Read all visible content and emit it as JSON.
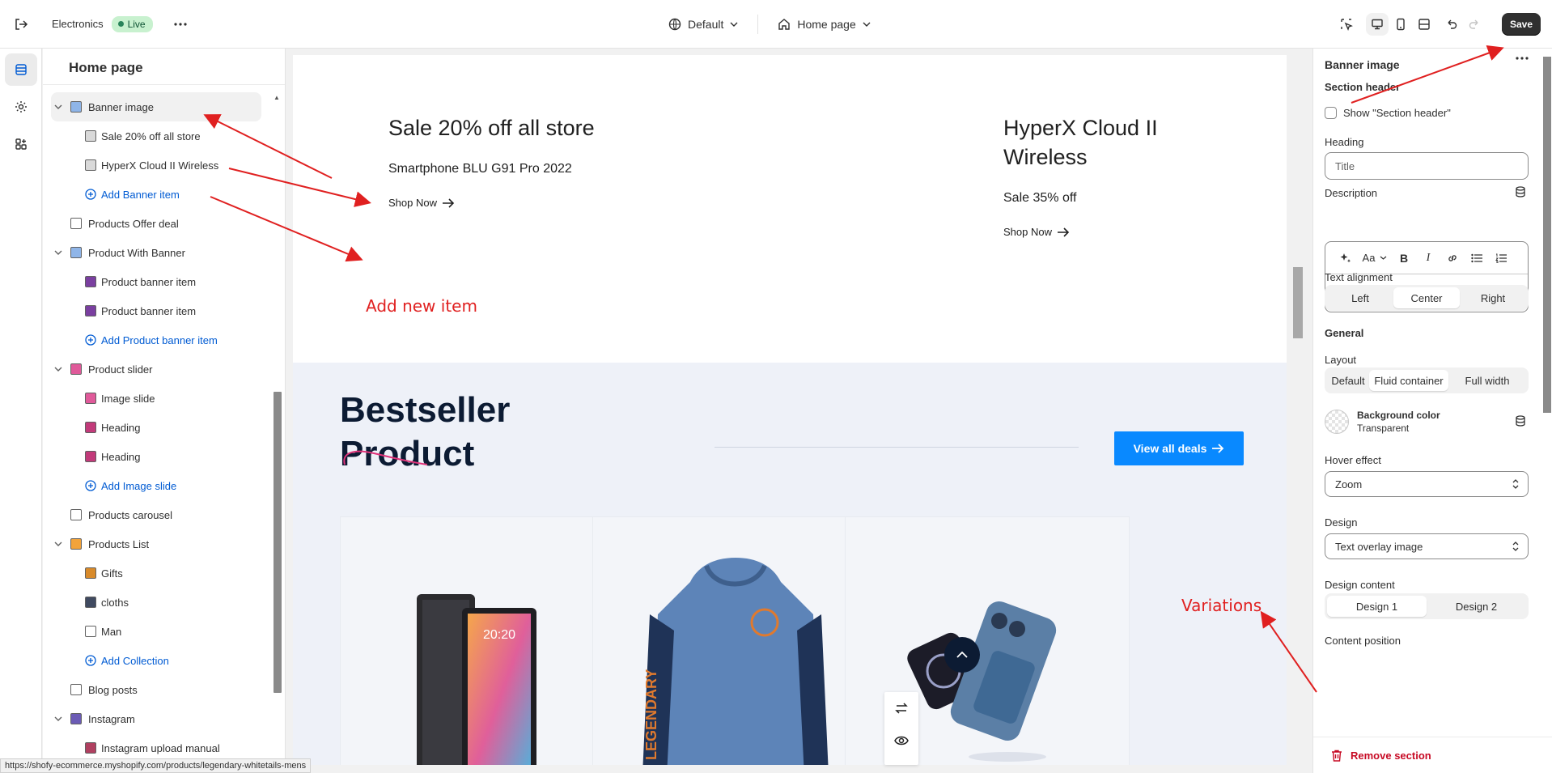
{
  "topbar": {
    "store_name": "Electronics",
    "status_badge": "Live",
    "theme_select": "Default",
    "page_select": "Home page",
    "save_label": "Save"
  },
  "sidebar": {
    "title": "Home page",
    "items": [
      {
        "label": "Banner image",
        "level": 1,
        "selected": true,
        "expanded": true,
        "icon": "banner-icon"
      },
      {
        "label": "Sale 20% off all store",
        "level": 2,
        "icon": "banner-item-icon"
      },
      {
        "label": "HyperX Cloud II Wireless",
        "level": 2,
        "icon": "banner-item-icon"
      },
      {
        "label": "Add Banner item",
        "level": 2,
        "add": true,
        "icon": "plus-circle-icon"
      },
      {
        "label": "Products Offer deal",
        "level": 1,
        "icon": "section-icon"
      },
      {
        "label": "Product With Banner",
        "level": 1,
        "expanded": true,
        "icon": "banner-icon"
      },
      {
        "label": "Product banner item",
        "level": 2,
        "icon": "product-banner-icon"
      },
      {
        "label": "Product banner item",
        "level": 2,
        "icon": "product-banner-icon"
      },
      {
        "label": "Add Product banner item",
        "level": 2,
        "add": true,
        "icon": "plus-circle-icon"
      },
      {
        "label": "Product slider",
        "level": 1,
        "expanded": true,
        "icon": "slider-icon"
      },
      {
        "label": "Image slide",
        "level": 2,
        "icon": "slide-icon"
      },
      {
        "label": "Heading",
        "level": 2,
        "icon": "heading-icon"
      },
      {
        "label": "Heading",
        "level": 2,
        "icon": "heading-icon"
      },
      {
        "label": "Add Image slide",
        "level": 2,
        "add": true,
        "icon": "plus-circle-icon"
      },
      {
        "label": "Products carousel",
        "level": 1,
        "icon": "section-icon"
      },
      {
        "label": "Products List",
        "level": 1,
        "expanded": true,
        "icon": "list-icon"
      },
      {
        "label": "Gifts",
        "level": 2,
        "icon": "gift-icon"
      },
      {
        "label": "cloths",
        "level": 2,
        "icon": "shirt-icon"
      },
      {
        "label": "Man",
        "level": 2,
        "icon": "tag-icon"
      },
      {
        "label": "Add Collection",
        "level": 2,
        "add": true,
        "icon": "plus-circle-icon"
      },
      {
        "label": "Blog posts",
        "level": 1,
        "icon": "blog-icon"
      },
      {
        "label": "Instagram",
        "level": 1,
        "expanded": true,
        "icon": "instagram-icon"
      },
      {
        "label": "Instagram upload manual",
        "level": 2,
        "icon": "image-icon"
      }
    ]
  },
  "preview": {
    "banner1": {
      "title": "Sale 20% off all store",
      "subtitle": "Smartphone BLU G91 Pro 2022",
      "cta": "Shop Now"
    },
    "banner2": {
      "title_line1": "HyperX Cloud II",
      "title_line2": "Wireless",
      "subtitle": "Sale 35% off",
      "cta": "Shop Now"
    },
    "section": {
      "title_line1": "Bestseller",
      "title_line2": "Product",
      "cta": "View all deals"
    },
    "tablet_time": "20:20",
    "hoodie_text": "LEGENDARY"
  },
  "settings": {
    "block_title": "Banner image",
    "section_header": "Section header",
    "show_header_label": "Show \"Section header\"",
    "heading_label": "Heading",
    "heading_placeholder": "Title",
    "description_label": "Description",
    "text_alignment_label": "Text alignment",
    "alignment_options": [
      "Left",
      "Center",
      "Right"
    ],
    "alignment_selected": "Center",
    "general_label": "General",
    "layout_label": "Layout",
    "layout_options": [
      "Default",
      "Fluid container",
      "Full width"
    ],
    "layout_selected": "Fluid container",
    "bg_color_label": "Background color",
    "bg_color_value": "Transparent",
    "hover_label": "Hover effect",
    "hover_value": "Zoom",
    "design_label": "Design",
    "design_value": "Text overlay image",
    "design_content_label": "Design content",
    "design_content_options": [
      "Design 1",
      "Design 2"
    ],
    "design_content_selected": "Design 1",
    "content_position_label": "Content position",
    "remove_label": "Remove section"
  },
  "annotations": {
    "add_new_item": "Add new item",
    "variations": "Variations"
  },
  "status_url": "https://shofy-ecommerce.myshopify.com/products/legendary-whitetails-mens",
  "colors": {
    "accent": "#005bd3",
    "live_badge": "#c8f1cf",
    "cta_blue": "#0989ff",
    "annotation": "#e02020",
    "danger": "#c70a24"
  }
}
